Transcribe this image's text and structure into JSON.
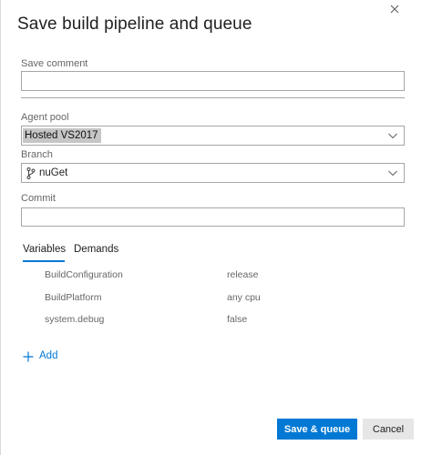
{
  "dialog": {
    "title": "Save build pipeline and queue"
  },
  "form": {
    "save_comment_label": "Save comment",
    "save_comment_value": "",
    "agent_pool_label": "Agent pool",
    "agent_pool_value": "Hosted VS2017",
    "branch_label": "Branch",
    "branch_value": "nuGet",
    "commit_label": "Commit",
    "commit_value": ""
  },
  "tabs": [
    {
      "label": "Variables",
      "active": true
    },
    {
      "label": "Demands",
      "active": false
    }
  ],
  "variables": [
    {
      "name": "BuildConfiguration",
      "value": "release"
    },
    {
      "name": "BuildPlatform",
      "value": "any cpu"
    },
    {
      "name": "system.debug",
      "value": "false"
    }
  ],
  "actions": {
    "add_label": "Add",
    "save_queue_label": "Save & queue",
    "cancel_label": "Cancel"
  },
  "colors": {
    "accent": "#0078d4",
    "cancel_bg": "#e6e6e6",
    "selection_bg": "#c6c6c6"
  },
  "icons": {
    "close": "close-icon",
    "dropdown": "chevron-down-icon",
    "branch": "git-branch-icon",
    "add": "plus-icon"
  }
}
